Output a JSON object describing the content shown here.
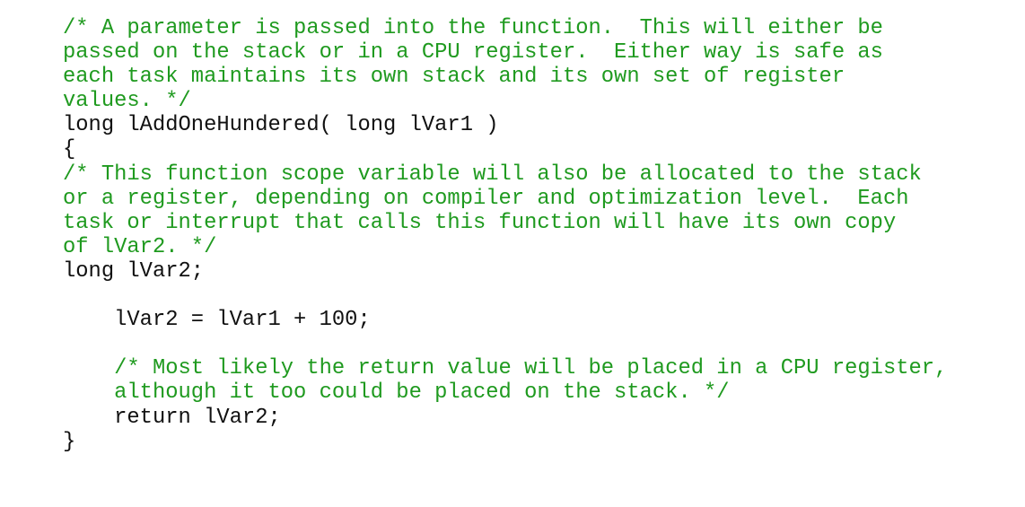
{
  "colors": {
    "comment": "#1f9a1f",
    "code": "#111111",
    "background": "#ffffff"
  },
  "lines": [
    {
      "type": "comment",
      "text": "/* A parameter is passed into the function.  This will either be"
    },
    {
      "type": "comment",
      "text": "passed on the stack or in a CPU register.  Either way is safe as"
    },
    {
      "type": "comment",
      "text": "each task maintains its own stack and its own set of register"
    },
    {
      "type": "comment",
      "text": "values. */"
    },
    {
      "type": "code",
      "text": "long lAddOneHundered( long lVar1 )"
    },
    {
      "type": "code",
      "text": "{"
    },
    {
      "type": "comment",
      "text": "/* This function scope variable will also be allocated to the stack"
    },
    {
      "type": "comment",
      "text": "or a register, depending on compiler and optimization level.  Each"
    },
    {
      "type": "comment",
      "text": "task or interrupt that calls this function will have its own copy"
    },
    {
      "type": "comment",
      "text": "of lVar2. */"
    },
    {
      "type": "code",
      "text": "long lVar2;"
    },
    {
      "type": "code",
      "text": ""
    },
    {
      "type": "code",
      "text": "    lVar2 = lVar1 + 100;"
    },
    {
      "type": "code",
      "text": ""
    },
    {
      "type": "comment",
      "text": "    /* Most likely the return value will be placed in a CPU register,"
    },
    {
      "type": "comment",
      "text": "    although it too could be placed on the stack. */"
    },
    {
      "type": "code",
      "text": "    return lVar2;"
    },
    {
      "type": "code",
      "text": "}"
    }
  ]
}
